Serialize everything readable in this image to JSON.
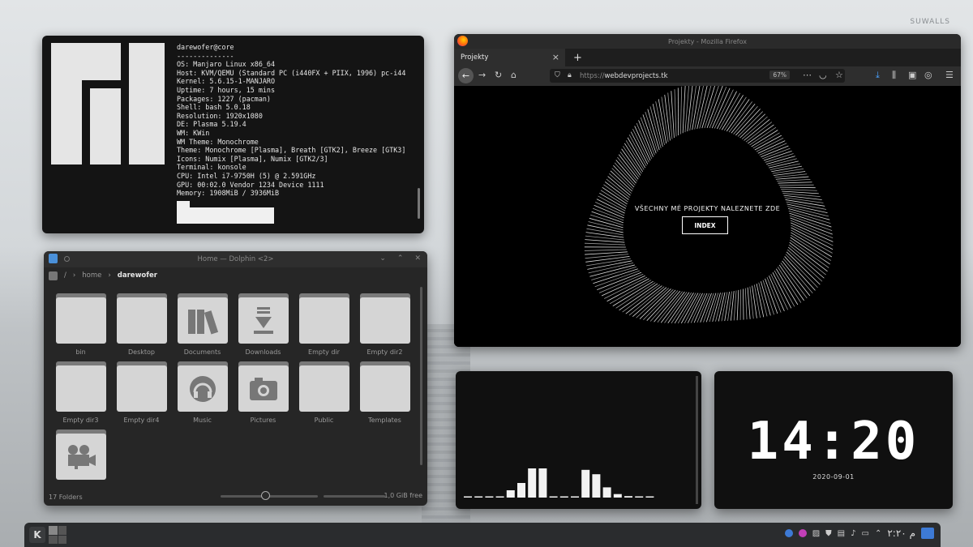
{
  "wallpaper": {
    "watermark": "SUWALLS"
  },
  "terminal": {
    "user_host": "darewofer@core",
    "separator": "--------------",
    "lines": [
      "OS: Manjaro Linux x86_64",
      "Host: KVM/QEMU (Standard PC (i440FX + PIIX, 1996) pc-i44",
      "Kernel: 5.6.15-1-MANJARO",
      "Uptime: 7 hours, 15 mins",
      "Packages: 1227 (pacman)",
      "Shell: bash 5.0.18",
      "Resolution: 1920x1080",
      "DE: Plasma 5.19.4",
      "WM: KWin",
      "WM Theme: Monochrome",
      "Theme: Monochrome [Plasma], Breath [GTK2], Breeze [GTK3]",
      "Icons: Numix [Plasma], Numix [GTK2/3]",
      "Terminal: konsole",
      "CPU: Intel i7-9750H (5) @ 2.591GHz",
      "GPU: 00:02.0 Vendor 1234 Device 1111",
      "Memory: 1908MiB / 3936MiB"
    ]
  },
  "dolphin": {
    "title": "Home — Dolphin <2>",
    "breadcrumb": {
      "root": "/",
      "home": "home",
      "current": "darewofer"
    },
    "items": [
      {
        "label": "bin",
        "icon": "folder-icon"
      },
      {
        "label": "Desktop",
        "icon": "folder-icon"
      },
      {
        "label": "Documents",
        "icon": "folder-documents-icon"
      },
      {
        "label": "Downloads",
        "icon": "folder-downloads-icon"
      },
      {
        "label": "Empty dir",
        "icon": "folder-icon"
      },
      {
        "label": "Empty dir2",
        "icon": "folder-icon"
      },
      {
        "label": "Empty dir3",
        "icon": "folder-icon"
      },
      {
        "label": "Empty dir4",
        "icon": "folder-icon"
      },
      {
        "label": "Music",
        "icon": "folder-music-icon"
      },
      {
        "label": "Pictures",
        "icon": "folder-pictures-icon"
      },
      {
        "label": "Public",
        "icon": "folder-icon"
      },
      {
        "label": "Templates",
        "icon": "folder-icon"
      },
      {
        "label": "",
        "icon": "folder-videos-icon"
      }
    ],
    "status": {
      "count": "17 Folders",
      "free": "1,0 GiB free"
    }
  },
  "firefox": {
    "window_title": "Projekty - Mozilla Firefox",
    "tab_label": "Projekty",
    "url_proto": "https://",
    "url_host": "webdevprojects.tk",
    "zoom": "67%",
    "hero_text": "VŠECHNY MÉ PROJEKTY NALEZNETE ZDE",
    "button_label": "INDEX"
  },
  "visualizer": {
    "bar_levels": [
      0.02,
      0.02,
      0.02,
      0.03,
      0.25,
      0.5,
      1.0,
      1.0,
      0.02,
      0.02,
      0.02,
      0.95,
      0.8,
      0.35,
      0.12,
      0.05,
      0.02,
      0.02
    ]
  },
  "clock": {
    "time": "14:20",
    "date": "2020-09-01"
  },
  "taskbar": {
    "launcher": "K",
    "time": "م ٢:٢٠"
  },
  "colors": {
    "accent": "#3d7ad5",
    "panel": "#2a2c2e"
  }
}
